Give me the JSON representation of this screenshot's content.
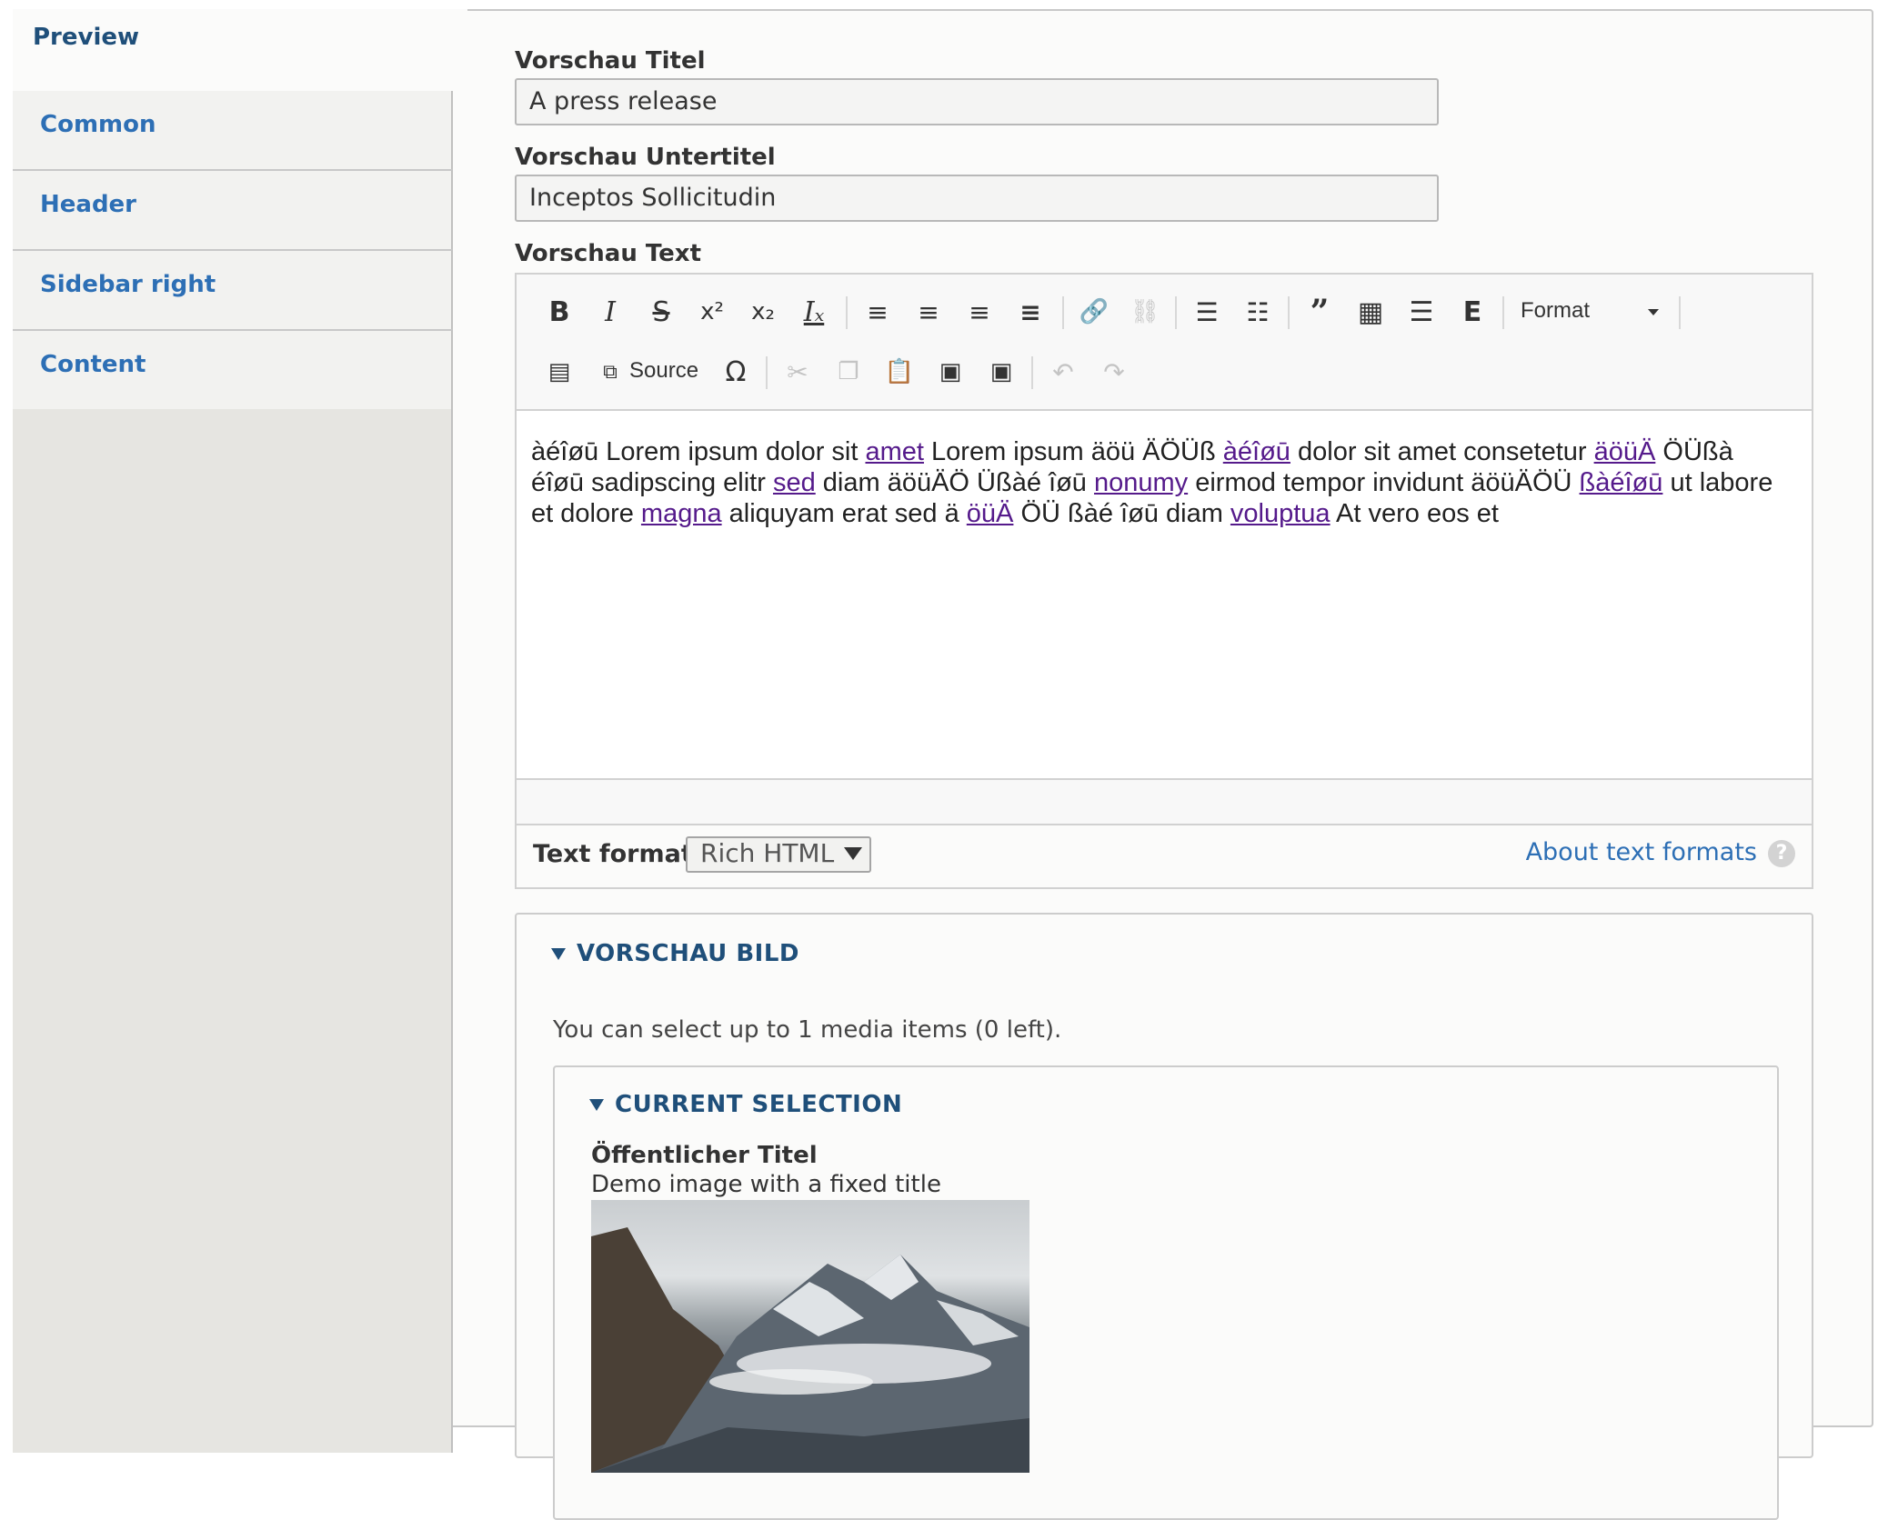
{
  "tabs": [
    {
      "label": "Preview",
      "active": true
    },
    {
      "label": "Common",
      "active": false
    },
    {
      "label": "Header",
      "active": false
    },
    {
      "label": "Sidebar right",
      "active": false
    },
    {
      "label": "Content",
      "active": false
    }
  ],
  "fields": {
    "title": {
      "label": "Vorschau Titel",
      "value": "A press release"
    },
    "subtitle": {
      "label": "Vorschau Untertitel",
      "value": "Inceptos Sollicitudin"
    },
    "text": {
      "label": "Vorschau Text"
    }
  },
  "toolbar": {
    "format_label": "Format",
    "source_label": "Source",
    "icons": [
      "bold-icon",
      "italic-icon",
      "strikethrough-icon",
      "superscript-icon",
      "subscript-icon",
      "remove-format-icon",
      "align-right-icon",
      "align-left-icon",
      "align-center-icon",
      "justify-icon",
      "link-icon",
      "unlink-icon",
      "bulleted-list-icon",
      "numbered-list-icon",
      "blockquote-icon",
      "table-icon",
      "horizontal-rule-icon",
      "entity-embed-icon",
      "show-blocks-icon",
      "source-icon",
      "special-char-icon",
      "cut-icon",
      "copy-icon",
      "paste-icon",
      "paste-text-icon",
      "paste-word-icon",
      "undo-icon",
      "redo-icon"
    ]
  },
  "editor": {
    "content": [
      {
        "t": "àéîøū Lorem ipsum dolor sit "
      },
      {
        "t": "amet",
        "link": true
      },
      {
        "t": " Lorem ipsum äöü ÄÖÜß "
      },
      {
        "t": "àéîøū",
        "link": true
      },
      {
        "t": " dolor sit amet consetetur "
      },
      {
        "t": "äöüÄ",
        "link": true
      },
      {
        "t": " ÖÜßà éîøū sadipscing elitr "
      },
      {
        "t": "sed",
        "link": true
      },
      {
        "t": " diam äöüÄÖ Üßàé îøū "
      },
      {
        "t": "nonumy",
        "link": true
      },
      {
        "t": " eirmod tempor invidunt äöüÄÖÜ "
      },
      {
        "t": "ßàéîøū",
        "link": true
      },
      {
        "t": " ut labore et dolore "
      },
      {
        "t": "magna",
        "link": true
      },
      {
        "t": " aliquyam erat sed ä "
      },
      {
        "t": "öüÄ",
        "link": true
      },
      {
        "t": " ÖÜ ßàé îøū diam "
      },
      {
        "t": "voluptua",
        "link": true
      },
      {
        "t": " At vero eos et"
      }
    ]
  },
  "text_format": {
    "label": "Text format",
    "selected": "Rich HTML",
    "about_link": "About text formats",
    "help": "?"
  },
  "media": {
    "summary": "VORSCHAU BILD",
    "description": "You can select up to 1 media items (0 left).",
    "selection_summary": "CURRENT SELECTION",
    "item_label": "Öffentlicher Titel",
    "item_title": "Demo image with a fixed title"
  }
}
